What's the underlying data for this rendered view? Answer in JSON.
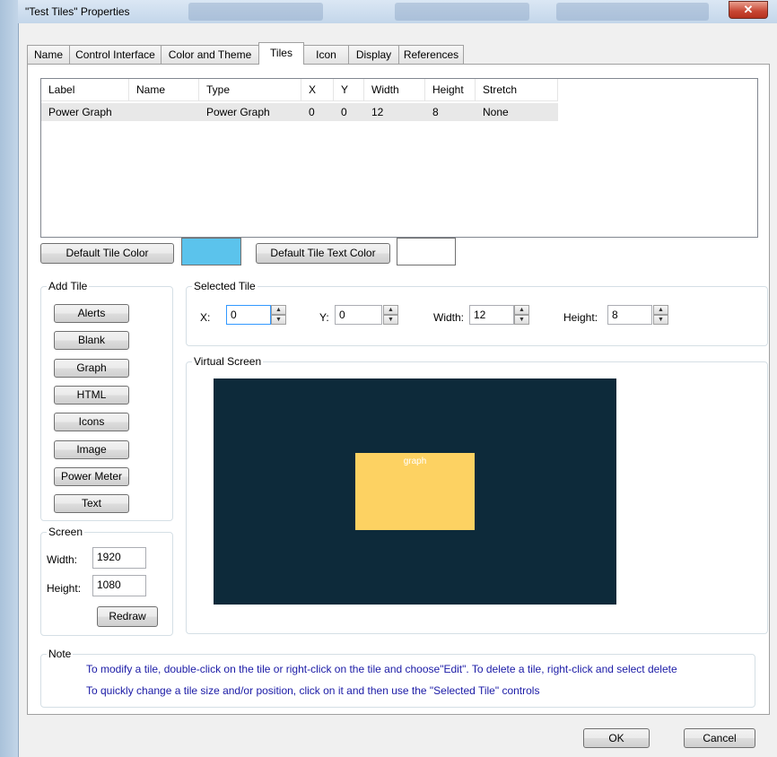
{
  "window": {
    "title": "\"Test Tiles\" Properties",
    "close_glyph": "✕"
  },
  "tabs": [
    {
      "label": "Name"
    },
    {
      "label": "Control Interface"
    },
    {
      "label": "Color and Theme"
    },
    {
      "label": "Tiles"
    },
    {
      "label": "Icon"
    },
    {
      "label": "Display"
    },
    {
      "label": "References"
    }
  ],
  "active_tab": "Tiles",
  "tiles_table": {
    "columns": [
      "Label",
      "Name",
      "Type",
      "X",
      "Y",
      "Width",
      "Height",
      "Stretch"
    ],
    "rows": [
      {
        "label": "Power Graph",
        "name": "",
        "type": "Power Graph",
        "x": "0",
        "y": "0",
        "width": "12",
        "height": "8",
        "stretch": "None"
      }
    ]
  },
  "default_colors": {
    "tile_color_button": "Default Tile Color",
    "tile_color_value": "#5bc3ec",
    "text_color_button": "Default Tile Text Color",
    "text_color_value": "#ffffff"
  },
  "add_tile": {
    "title": "Add Tile",
    "buttons": [
      "Alerts",
      "Blank",
      "Graph",
      "HTML",
      "Icons",
      "Image",
      "Power Meter",
      "Text"
    ]
  },
  "screen": {
    "title": "Screen",
    "width_label": "Width:",
    "width_value": "1920",
    "height_label": "Height:",
    "height_value": "1080",
    "redraw_button": "Redraw"
  },
  "selected_tile": {
    "title": "Selected Tile",
    "x_label": "X:",
    "x_value": "0",
    "y_label": "Y:",
    "y_value": "0",
    "width_label": "Width:",
    "width_value": "12",
    "height_label": "Height:",
    "height_value": "8"
  },
  "virtual_screen": {
    "title": "Virtual Screen",
    "background": "#0d2a3a",
    "tile_color": "#fdd262",
    "tile_label": "graph"
  },
  "note": {
    "title": "Note",
    "line1": "To modify a tile, double-click on the tile or right-click on the tile and choose\"Edit\".  To delete a tile, right-click and select delete",
    "line2": "To quickly change a tile size and/or position, click on it and then use the \"Selected Tile\" controls"
  },
  "footer": {
    "ok_button": "OK",
    "cancel_button": "Cancel"
  }
}
